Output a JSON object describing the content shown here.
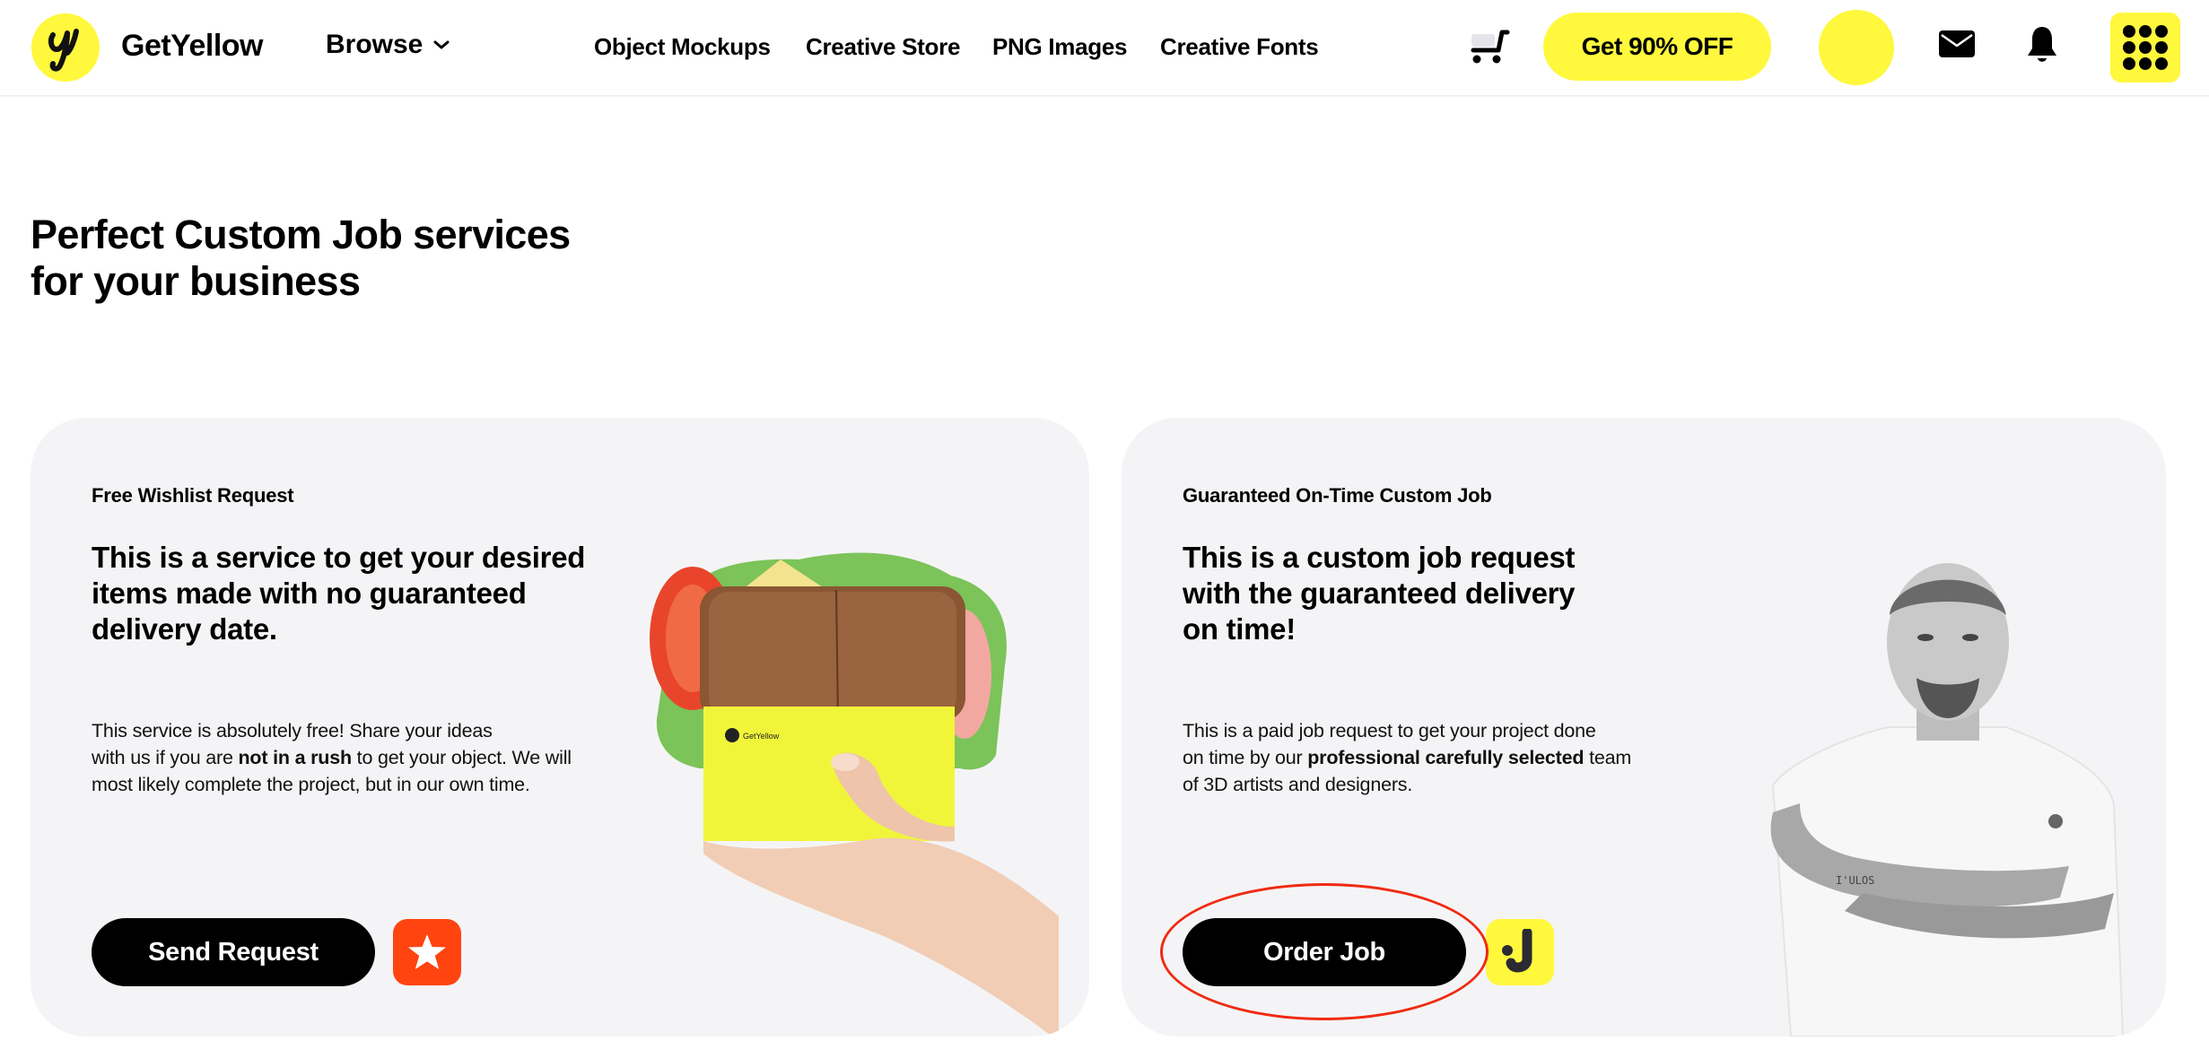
{
  "header": {
    "brand": "GetYellow",
    "logo_glyph": "y",
    "browse_label": "Browse",
    "nav_links": [
      {
        "label": "Object Mockups"
      },
      {
        "label": "Creative Store"
      },
      {
        "label": "PNG Images"
      },
      {
        "label": "Creative Fonts"
      }
    ],
    "promo_label": "Get 90% OFF",
    "icons": {
      "cart": "shopping-cart-icon",
      "avatar": "user-avatar",
      "mail": "envelope-icon",
      "bell": "bell-icon",
      "apps": "apps-grid-icon"
    }
  },
  "page": {
    "title_line1": "Perfect Custom Job services",
    "title_line2": "for your business"
  },
  "cards": [
    {
      "label": "Free Wishlist Request",
      "title_lines": [
        "This is a service to get your desired",
        "items made with no guaranteed",
        "delivery date."
      ],
      "body": {
        "line1": "This service is absolutely free! Share your ideas",
        "line2_pre": "with us if you are ",
        "line2_bold": "not in a rush",
        "line2_post": " to get your object. We will",
        "line3": "most likely complete the project, but in our own time."
      },
      "button_label": "Send Request",
      "badge_icon": "star-icon",
      "image": "sandwich-in-yellow-wrapper-held-by-hand",
      "wrapper_brand": "GetYellow"
    },
    {
      "label": "Guaranteed On-Time Custom Job",
      "title_lines": [
        "This is a custom job request",
        "with the guaranteed delivery",
        "on time!"
      ],
      "body": {
        "line1": "This is a paid job request to get your project done",
        "line2_pre": "on time by our ",
        "line2_bold": "professional carefully selected",
        "line2_post": " team",
        "line3": "of 3D artists and designers."
      },
      "button_label": "Order Job",
      "badge_icon": "j-logo-icon",
      "image": "man-with-crossed-arms-black-and-white"
    }
  ],
  "colors": {
    "brand_yellow": "#FFF83D",
    "card_bg": "#F4F4F6",
    "star_orange": "#FF4410",
    "highlight_red": "#F02A10",
    "text": "#000000"
  }
}
